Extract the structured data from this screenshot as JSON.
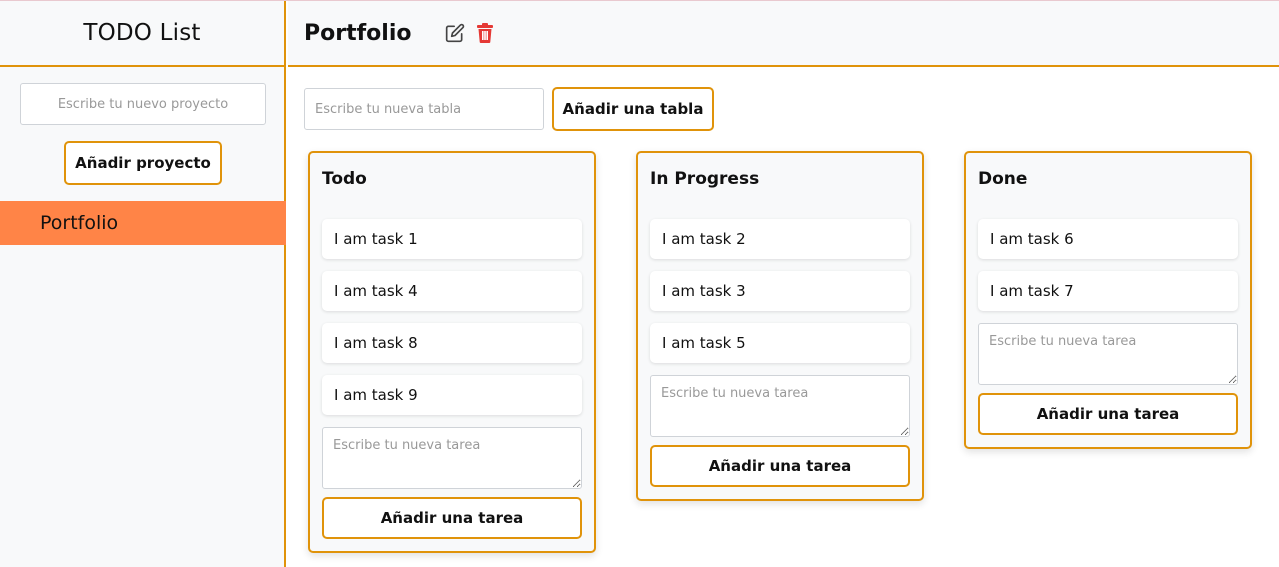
{
  "sidebar": {
    "title": "TODO List",
    "new_project_placeholder": "Escribe tu nuevo proyecto",
    "add_project_label": "Añadir proyecto",
    "projects": [
      {
        "label": "Portfolio",
        "active": true
      }
    ]
  },
  "header": {
    "project_title": "Portfolio",
    "edit_icon": "edit-icon",
    "delete_icon": "trash-icon"
  },
  "toolbar": {
    "new_table_placeholder": "Escribe tu nueva tabla",
    "add_table_label": "Añadir una tabla"
  },
  "boards": [
    {
      "title": "Todo",
      "tasks": [
        "I am task 1",
        "I am task 4",
        "I am task 8",
        "I am task 9"
      ],
      "new_task_placeholder": "Escribe tu nueva tarea",
      "add_task_label": "Añadir una tarea"
    },
    {
      "title": "In Progress",
      "tasks": [
        "I am task 2",
        "I am task 3",
        "I am task 5"
      ],
      "new_task_placeholder": "Escribe tu nueva tarea",
      "add_task_label": "Añadir una tarea"
    },
    {
      "title": "Done",
      "tasks": [
        "I am task 6",
        "I am task 7"
      ],
      "new_task_placeholder": "Escribe tu nueva tarea",
      "add_task_label": "Añadir una tarea"
    }
  ],
  "colors": {
    "accent": "#e0930a",
    "active_project": "#ff8447",
    "delete": "#e53935",
    "panel_bg": "#f8f9fa"
  }
}
